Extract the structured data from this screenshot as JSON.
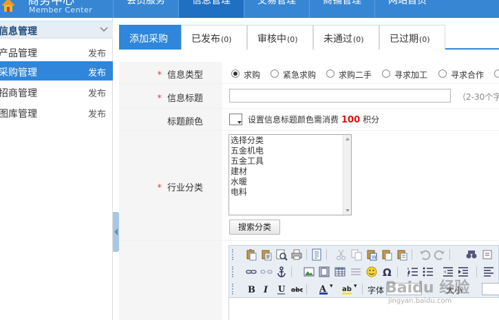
{
  "header": {
    "logo_title": "商务中心",
    "logo_subtitle": "Member Center",
    "nav": [
      "会员服务",
      "信息管理",
      "交易管理",
      "商铺管理",
      "网站首页"
    ],
    "active_nav": 1
  },
  "sidebar": {
    "section_title": "信息管理",
    "items": [
      {
        "label": "产品管理",
        "action": "发布"
      },
      {
        "label": "采购管理",
        "action": "发布"
      },
      {
        "label": "招商管理",
        "action": "发布"
      },
      {
        "label": "图库管理",
        "action": "发布"
      }
    ],
    "active_item": 1
  },
  "tabs": [
    {
      "label": "添加采购",
      "count": ""
    },
    {
      "label": "已发布",
      "count": "(0)"
    },
    {
      "label": "审核中",
      "count": "(0)"
    },
    {
      "label": "未通过",
      "count": "(0)"
    },
    {
      "label": "已过期",
      "count": "(0)"
    }
  ],
  "form": {
    "type_label": "信息类型",
    "type_options": [
      "求购",
      "紧急求购",
      "求购二手",
      "寻求加工",
      "寻求合作"
    ],
    "type_selected": "求购",
    "title_label": "信息标题",
    "title_value": "",
    "title_hint": "（2-30个字",
    "color_label": "标题颜色",
    "color_note_prefix": "设置信息标题颜色需消费",
    "color_cost": "100",
    "color_note_suffix": "积分",
    "category_label": "行业分类",
    "category_options": [
      "选择分类",
      "五金机电",
      "五金工具",
      "建材",
      "水暖",
      "电料"
    ],
    "search_category_button": "搜索分类",
    "required_mark": "*"
  },
  "editor": {
    "font_label": "字体",
    "size_label": "大小"
  },
  "watermark": {
    "text": "Baidu 经验",
    "url": "jingyan.baidu.com"
  },
  "colors": {
    "primary": "#2f86da",
    "header": "#3786d4",
    "required": "#e23b3b",
    "cost": "#e01010"
  }
}
